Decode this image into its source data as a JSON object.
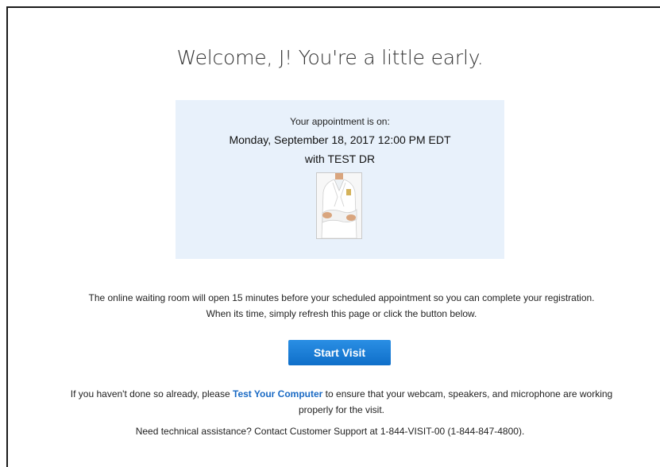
{
  "welcome": {
    "title": "Welcome, J! You're a little early."
  },
  "appointment": {
    "intro": "Your appointment is on:",
    "datetime": "Monday, September 18, 2017 12:00 PM EDT",
    "doctor": "with TEST DR"
  },
  "info": {
    "message": "The online waiting room will open 15 minutes before your scheduled appointment so you can complete your registration. When its time, simply refresh this page or click the button below."
  },
  "actions": {
    "start_visit_label": "Start Visit"
  },
  "test_computer": {
    "prefix": "If you haven't done so already, please ",
    "link_label": "Test Your Computer",
    "suffix": " to ensure that your webcam, speakers, and microphone are working properly for the visit."
  },
  "support": {
    "message": "Need technical assistance? Contact Customer Support at 1-844-VISIT-00 (1-844-847-4800)."
  },
  "colors": {
    "accent": "#1a6ac4",
    "button": "#1a7fd8",
    "panel": "#e8f1fb"
  }
}
